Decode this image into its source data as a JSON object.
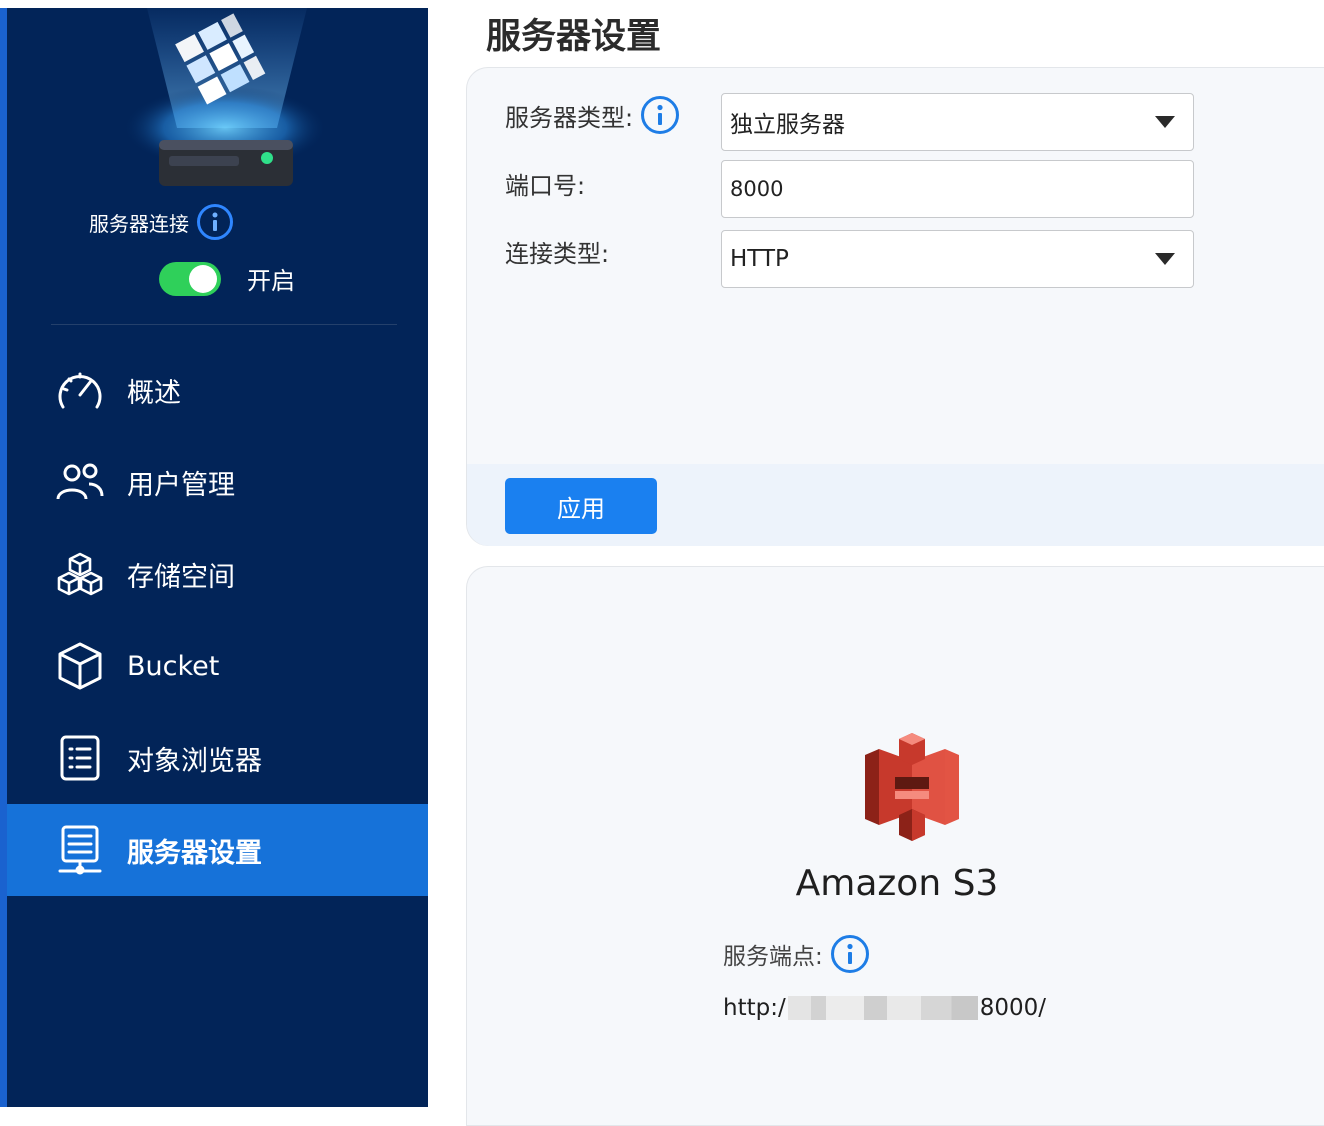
{
  "sidebar": {
    "connection_label": "服务器连接",
    "toggle_state_label": "开启",
    "toggle_on": true,
    "items": [
      {
        "label": "概述",
        "icon": "speedometer-icon"
      },
      {
        "label": "用户管理",
        "icon": "users-icon"
      },
      {
        "label": "存储空间",
        "icon": "storage-cubes-icon"
      },
      {
        "label": "Bucket",
        "icon": "cube-icon"
      },
      {
        "label": "对象浏览器",
        "icon": "document-list-icon"
      },
      {
        "label": "服务器设置",
        "icon": "server-settings-icon",
        "active": true
      }
    ]
  },
  "main": {
    "title": "服务器设置",
    "form": {
      "server_type_label": "服务器类型:",
      "server_type_value": "独立服务器",
      "port_label": "端口号:",
      "port_value": "8000",
      "connection_type_label": "连接类型:",
      "connection_type_value": "HTTP"
    },
    "apply_label": "应用",
    "s3": {
      "title": "Amazon S3",
      "endpoint_label": "服务端点:",
      "endpoint_prefix": "http:/",
      "endpoint_suffix": "8000/"
    }
  },
  "colors": {
    "sidebar_bg": "#022458",
    "active_item": "#1672d9",
    "toggle_on": "#2fd05a",
    "apply_button": "#1a80f0",
    "info_icon": "#1e7de6",
    "s3_red": "#c7392c"
  }
}
